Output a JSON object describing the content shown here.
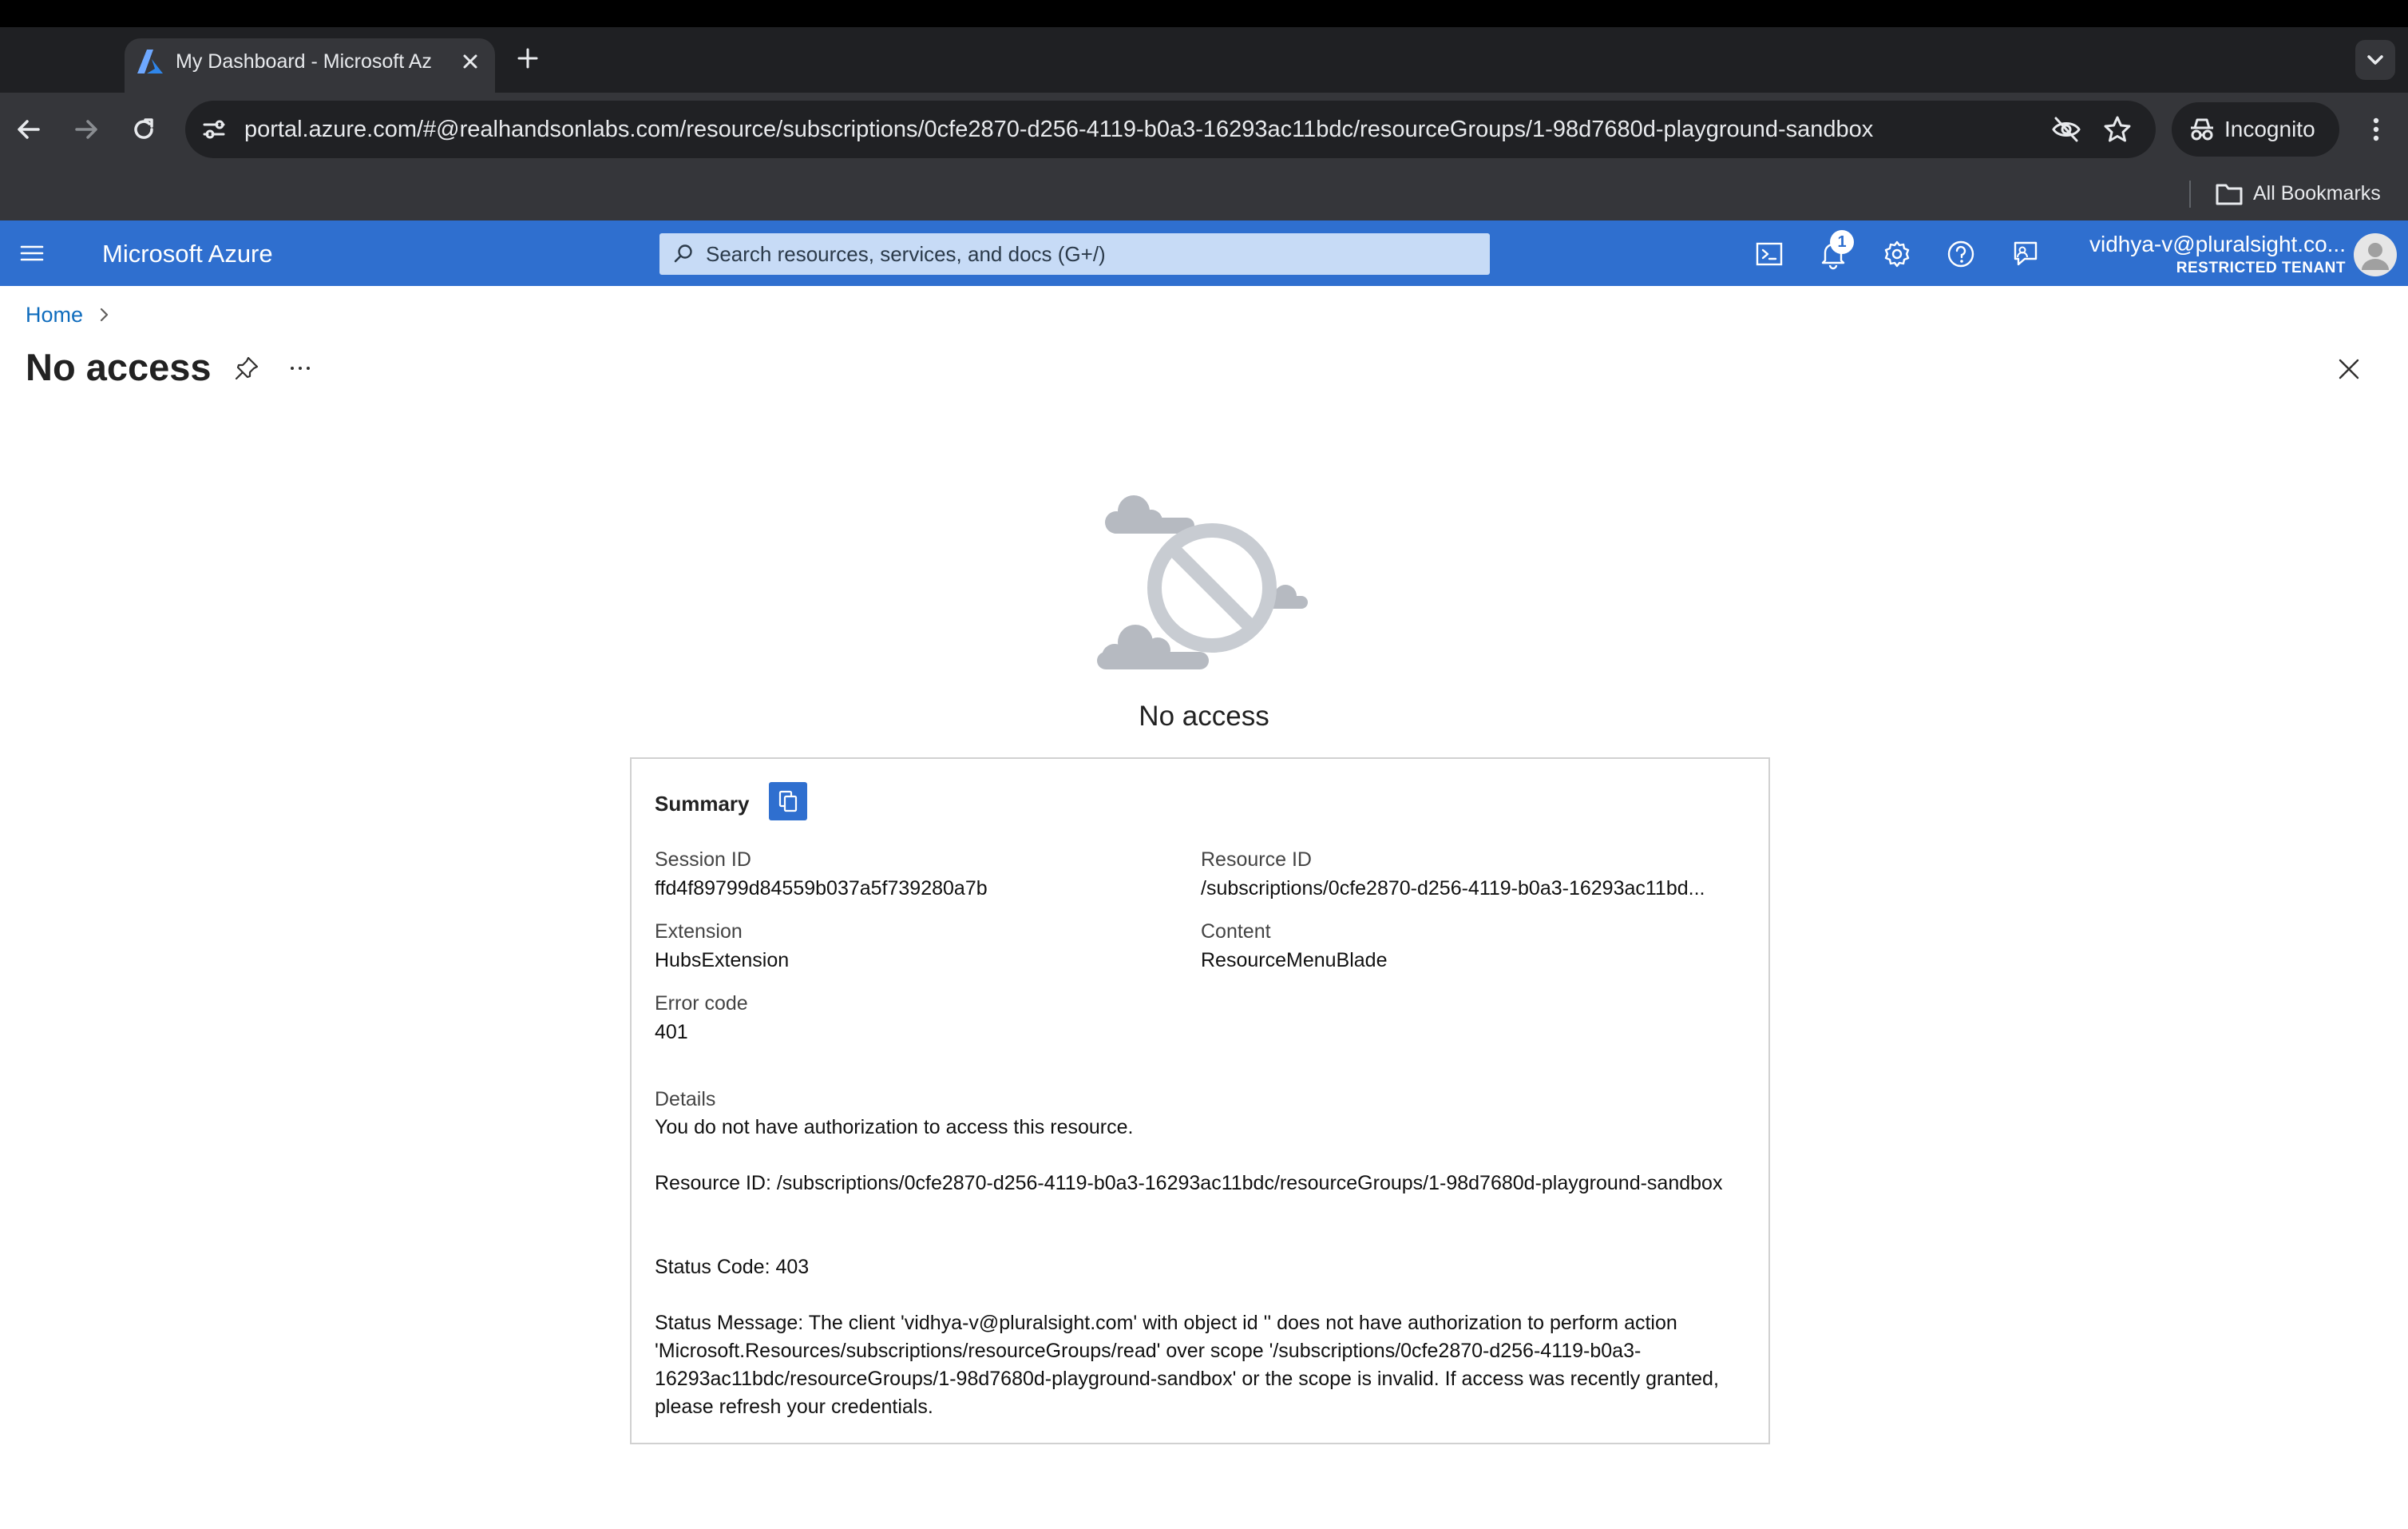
{
  "browser": {
    "tab_title": "My Dashboard - Microsoft Az",
    "url": "portal.azure.com/#@realhandsonlabs.com/resource/subscriptions/0cfe2870-d256-4119-b0a3-16293ac11bdc/resourceGroups/1-98d7680d-playground-sandbox",
    "incognito_label": "Incognito",
    "bookmarks_label": "All Bookmarks"
  },
  "azure_header": {
    "brand": "Microsoft Azure",
    "search_placeholder": "Search resources, services, and docs (G+/)",
    "notification_count": "1",
    "account_name": "vidhya-v@pluralsight.co...",
    "tenant_label": "RESTRICTED TENANT"
  },
  "blade": {
    "breadcrumb_home": "Home",
    "title": "No access"
  },
  "no_access": {
    "heading": "No access"
  },
  "summary": {
    "title": "Summary",
    "session_id_label": "Session ID",
    "session_id_value": "ffd4f89799d84559b037a5f739280a7b",
    "resource_id_label": "Resource ID",
    "resource_id_value": "/subscriptions/0cfe2870-d256-4119-b0a3-16293ac11bd...",
    "extension_label": "Extension",
    "extension_value": "HubsExtension",
    "content_label": "Content",
    "content_value": "ResourceMenuBlade",
    "error_code_label": "Error code",
    "error_code_value": "401",
    "details_label": "Details",
    "details_line1": "You do not have authorization to access this resource.",
    "details_resource": "Resource ID: /subscriptions/0cfe2870-d256-4119-b0a3-16293ac11bdc/resourceGroups/1-98d7680d-playground-sandbox",
    "details_status_code": "Status Code: 403",
    "details_status_message": "Status Message: The client 'vidhya-v@pluralsight.com' with object id '' does not have authorization to perform action 'Microsoft.Resources/subscriptions/resourceGroups/read' over scope '/subscriptions/0cfe2870-d256-4119-b0a3-16293ac11bdc/resourceGroups/1-98d7680d-playground-sandbox' or the scope is invalid. If access was recently granted, please refresh your credentials."
  },
  "colors": {
    "azure_blue": "#2f6fcf",
    "link_blue": "#0f6cbd",
    "browser_dark": "#35363a"
  },
  "icons": [
    "azure-favicon-icon",
    "close-tab-icon",
    "new-tab-icon",
    "tab-search-icon",
    "back-icon",
    "forward-icon",
    "reload-icon",
    "site-info-icon",
    "eye-off-icon",
    "star-icon",
    "incognito-icon",
    "menu-dots-icon",
    "folder-icon",
    "hamburger-icon",
    "search-icon",
    "cloud-shell-icon",
    "bell-icon",
    "settings-icon",
    "help-icon",
    "feedback-icon",
    "avatar-icon",
    "chevron-right-icon",
    "pin-icon",
    "more-icon",
    "close-icon",
    "no-access-icon",
    "copy-icon"
  ]
}
